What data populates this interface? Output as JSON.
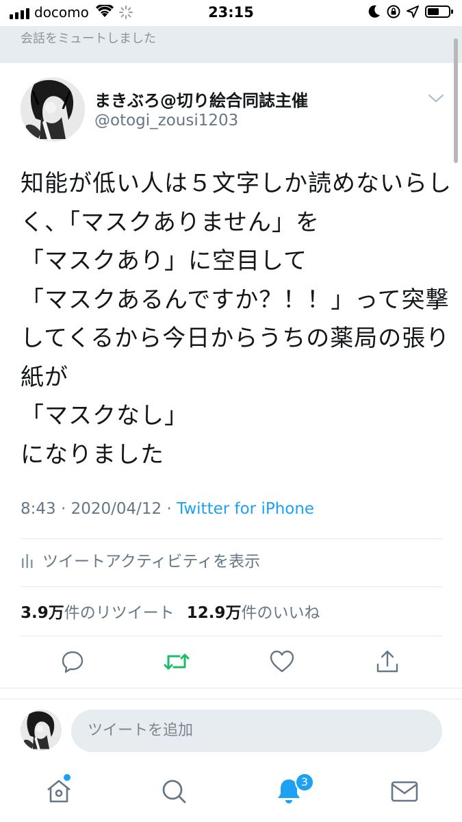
{
  "status_bar": {
    "carrier": "docomo",
    "time": "23:15"
  },
  "banner": {
    "text": "会話をミュートしました"
  },
  "tweet": {
    "author_name": "まきぶろ@切り絵合同誌主催",
    "author_handle": "@otogi_zousi1203",
    "text": "知能が低い人は５文字しか読めないらしく、「マスクありません」を\n「マスクあり」に空目して\n「マスクあるんですか？！！」って突撃してくるから今日からうちの薬局の張り紙が\n「マスクなし」\nになりました",
    "time": "8:43",
    "date": "2020/04/12",
    "separator": "·",
    "source": "Twitter for iPhone",
    "activity_label": "ツイートアクティビティを表示",
    "retweet_count": "3.9万",
    "retweet_label": "件のリツイート",
    "like_count": "12.9万",
    "like_label": "件のいいね"
  },
  "reply": {
    "placeholder": "ツイートを追加"
  },
  "tab_bar": {
    "notification_badge": "3"
  },
  "colors": {
    "accent": "#1da1f2",
    "retweet_green": "#17bf63",
    "muted_gray": "#657786",
    "banner_bg": "#e6ecf0"
  }
}
